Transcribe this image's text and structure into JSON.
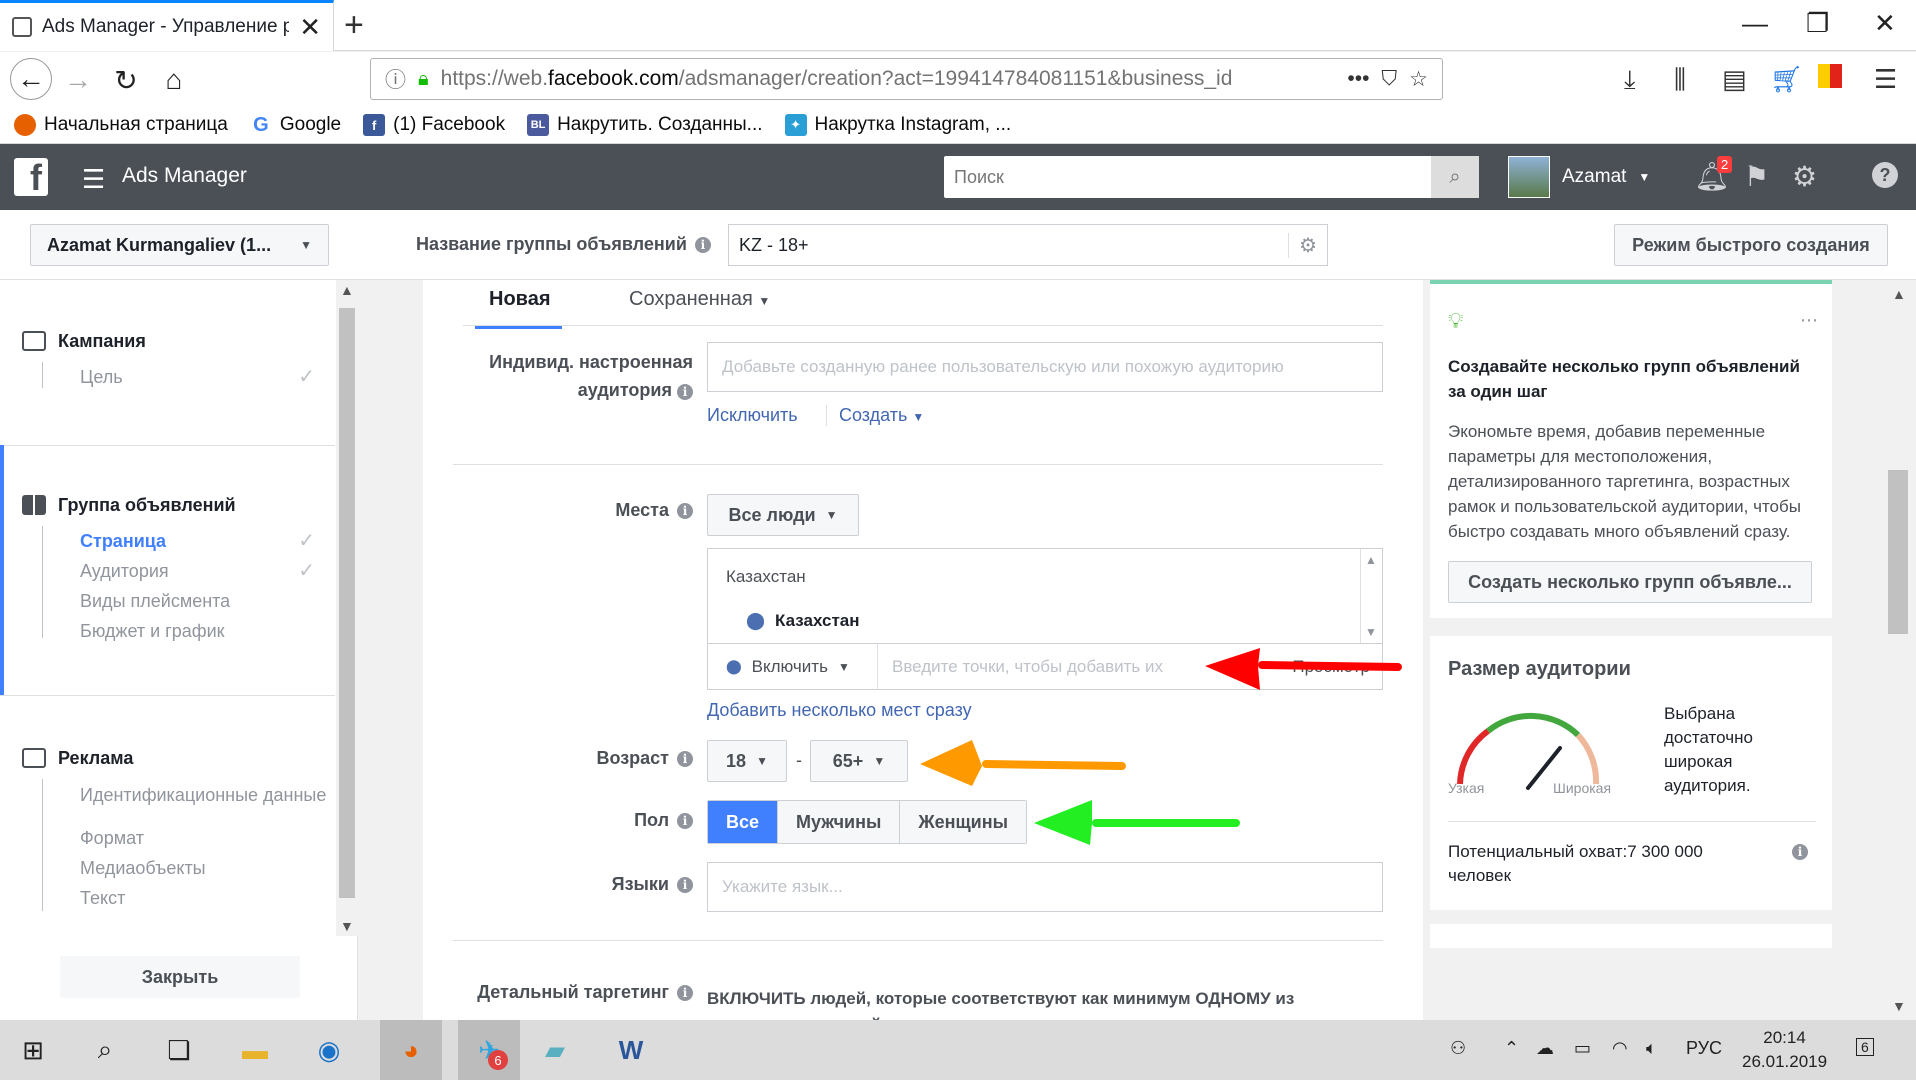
{
  "browser": {
    "tab_title": "Ads Manager - Управление ре",
    "url_prefix": "https://web.",
    "url_domain": "facebook.com",
    "url_suffix": "/adsmanager/creation?act=199414784081151&business_id",
    "bookmarks": [
      {
        "label": "Начальная страница",
        "color": "#e66000"
      },
      {
        "label": "Google",
        "color": "#4285f4"
      },
      {
        "label": "(1) Facebook",
        "color": "#3b5998"
      },
      {
        "label": "Накрутить. Созданны...",
        "color": "#4a5a9c"
      },
      {
        "label": "Накрутка Instagram, ...",
        "color": "#2a9fd6"
      }
    ]
  },
  "header": {
    "app_name": "Ads Manager",
    "search_placeholder": "Поиск",
    "user_name": "Azamat",
    "notif_count": "2"
  },
  "subheader": {
    "account": "Azamat Kurmangaliev (1...",
    "group_name_label": "Название группы объявлений",
    "group_name_value": "KZ - 18+",
    "quick_mode": "Режим быстрого создания"
  },
  "leftnav": {
    "campaign": "Кампания",
    "campaign_items": [
      "Цель"
    ],
    "adset": "Группа объявлений",
    "adset_items": [
      "Страница",
      "Аудитория",
      "Виды плейсмента",
      "Бюджет и график"
    ],
    "ad": "Реклама",
    "ad_items": [
      "Идентификационные данные",
      "Формат",
      "Медиаобъекты",
      "Текст"
    ],
    "close": "Закрыть"
  },
  "form": {
    "tab_new": "Новая",
    "tab_saved": "Сохраненная",
    "custom_aud_label_1": "Индивид. настроенная",
    "custom_aud_label_2": "аудитория",
    "custom_aud_placeholder": "Добавьте созданную ранее пользовательскую или похожую аудиторию",
    "exclude": "Исключить",
    "create": "Создать",
    "places_label": "Места",
    "places_dropdown": "Все люди",
    "loc_country": "Казахстан",
    "loc_selected": "Казахстан",
    "include": "Включить",
    "loc_input_placeholder": "Введите точки, чтобы добавить их",
    "loc_browse": "Просмотр",
    "add_many": "Добавить несколько мест сразу",
    "age_label": "Возраст",
    "age_min": "18",
    "age_max": "65+",
    "age_dash": "-",
    "gender_label": "Пол",
    "gender_all": "Все",
    "gender_men": "Мужчины",
    "gender_women": "Женщины",
    "lang_label": "Языки",
    "lang_placeholder": "Укажите язык...",
    "detail_label": "Детальный таргетинг",
    "detail_text": "ВКЛЮЧИТЬ людей, которые соответствуют как минимум ОДНОМУ из следующих условий"
  },
  "tip": {
    "title": "Создавайте несколько групп объявлений за один шаг",
    "body": "Экономьте время, добавив переменные параметры для местоположения, детализированного таргетинга, возрастных рамок и пользовательской аудитории, чтобы быстро создавать много объявлений сразу.",
    "button": "Создать несколько групп объявле..."
  },
  "audience": {
    "title": "Размер аудитории",
    "narrow": "Узкая",
    "wide": "Широкая",
    "status": "Выбрана достаточно широкая аудитория.",
    "reach": "Потенциальный охват:7 300 000 человек"
  },
  "taskbar": {
    "lang": "РУС",
    "time": "20:14",
    "date": "26.01.2019",
    "telegram_badge": "6",
    "notif_count": "6"
  },
  "colors": {
    "arrow_red": "#ff0000",
    "arrow_orange": "#ff9900",
    "arrow_green": "#22ee22",
    "fb_blue": "#4080ff"
  }
}
